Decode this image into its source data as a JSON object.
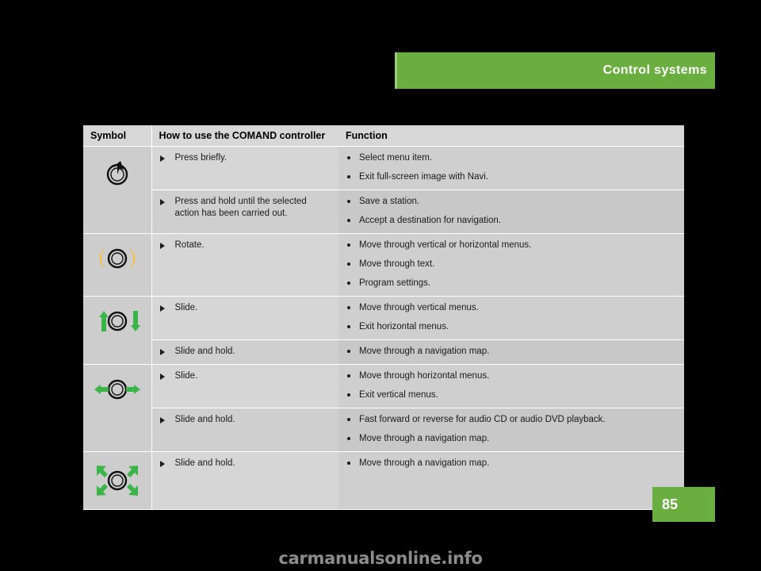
{
  "header": {
    "title": "Control systems",
    "accent_color": "#6aae3f"
  },
  "page": {
    "number": "85",
    "background_color": "#000000"
  },
  "watermark": {
    "text": "carmanualsonline.info"
  },
  "table": {
    "columns": [
      {
        "key": "symbol",
        "label": "Symbol"
      },
      {
        "key": "howto",
        "label": "How to use the COMAND controller"
      },
      {
        "key": "function",
        "label": "Function"
      }
    ],
    "groups": [
      {
        "symbol_icon": "press-controller-icon",
        "rows": [
          {
            "actions": [
              "Press briefly."
            ],
            "functions": [
              "Select menu item.",
              "Exit full-screen image with Navi."
            ]
          },
          {
            "actions": [
              "Press and hold until the selected action has been carried out."
            ],
            "functions": [
              "Save a station.",
              "Accept a destination for navigation."
            ]
          }
        ]
      },
      {
        "symbol_icon": "rotate-controller-icon",
        "rows": [
          {
            "actions": [
              "Rotate."
            ],
            "functions": [
              "Move through vertical or horizontal menus.",
              "Move through text.",
              "Program settings."
            ]
          }
        ]
      },
      {
        "symbol_icon": "slide-vertical-controller-icon",
        "rows": [
          {
            "actions": [
              "Slide."
            ],
            "functions": [
              "Move through vertical menus.",
              "Exit horizontal menus."
            ]
          },
          {
            "actions": [
              "Slide and hold."
            ],
            "functions": [
              "Move through a navigation map."
            ]
          }
        ]
      },
      {
        "symbol_icon": "slide-horizontal-controller-icon",
        "rows": [
          {
            "actions": [
              "Slide."
            ],
            "functions": [
              "Move through horizontal menus.",
              "Exit vertical menus."
            ]
          },
          {
            "actions": [
              "Slide and hold."
            ],
            "functions": [
              "Fast forward or reverse for audio CD or audio DVD playback.",
              "Move through a navigation map."
            ]
          }
        ]
      },
      {
        "symbol_icon": "slide-diagonal-controller-icon",
        "rows": [
          {
            "actions": [
              "Slide and hold."
            ],
            "functions": [
              "Move through a navigation map."
            ]
          }
        ]
      }
    ]
  },
  "colors": {
    "arrow_green": "#3bb54a",
    "arrow_yellow": "#fcbf1e",
    "table_header_bg": "#d7d7d7",
    "symbol_col_bg": "#cdcdcd"
  }
}
